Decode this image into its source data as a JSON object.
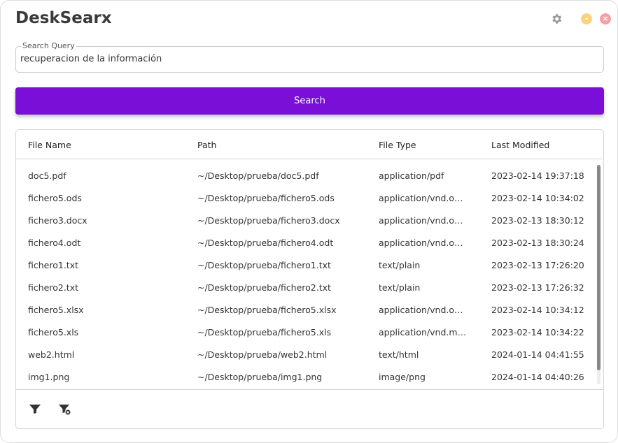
{
  "app": {
    "title": "DeskSearx"
  },
  "search": {
    "label": "Search Query",
    "value": "recuperacion de la información",
    "button": "Search"
  },
  "table": {
    "columns": [
      "File Name",
      "Path",
      "File Type",
      "Last Modified"
    ],
    "rows": [
      [
        "doc5.pdf",
        "~/Desktop/prueba/doc5.pdf",
        "application/pdf",
        "2023-02-14 19:37:18"
      ],
      [
        "fichero5.ods",
        "~/Desktop/prueba/fichero5.ods",
        "application/vnd.oasis.opendocument.spreadsheet",
        "2023-02-14 10:34:02"
      ],
      [
        "fichero3.docx",
        "~/Desktop/prueba/fichero3.docx",
        "application/vnd.openxmlformats-officedocument.wordprocessingml.document",
        "2023-02-13 18:30:12"
      ],
      [
        "fichero4.odt",
        "~/Desktop/prueba/fichero4.odt",
        "application/vnd.oasis.opendocument.text",
        "2023-02-13 18:30:24"
      ],
      [
        "fichero1.txt",
        "~/Desktop/prueba/fichero1.txt",
        "text/plain",
        "2023-02-13 17:26:20"
      ],
      [
        "fichero2.txt",
        "~/Desktop/prueba/fichero2.txt",
        "text/plain",
        "2023-02-13 17:26:32"
      ],
      [
        "fichero5.xlsx",
        "~/Desktop/prueba/fichero5.xlsx",
        "application/vnd.openxmlformats-officedocument.spreadsheetml.sheet",
        "2023-02-14 10:34:12"
      ],
      [
        "fichero5.xls",
        "~/Desktop/prueba/fichero5.xls",
        "application/vnd.ms-excel",
        "2023-02-14 10:34:22"
      ],
      [
        "web2.html",
        "~/Desktop/prueba/web2.html",
        "text/html",
        "2024-01-14 04:41:55"
      ],
      [
        "img1.png",
        "~/Desktop/prueba/img1.png",
        "image/png",
        "2024-01-14 04:40:26"
      ]
    ]
  },
  "icons": {
    "settings": "gear-icon",
    "minimize": "minimize-icon",
    "close": "close-icon",
    "filter": "filter-icon",
    "clear_filter": "filter-remove-icon"
  },
  "colors": {
    "accent": "#7a0fd8",
    "minimize": "#fdd27d",
    "close": "#f4a0a4"
  }
}
